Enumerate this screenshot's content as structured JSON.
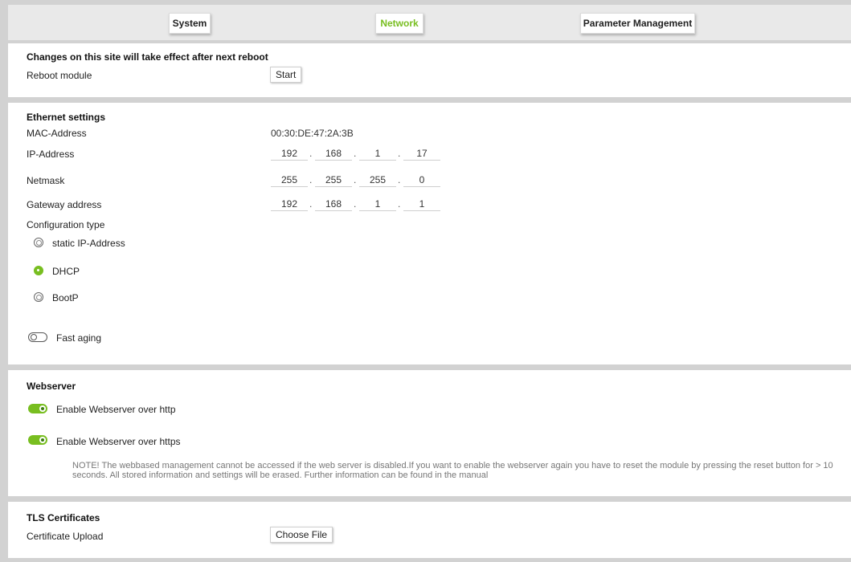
{
  "tabs": [
    {
      "label": "System",
      "active": false
    },
    {
      "label": "Network",
      "active": true
    },
    {
      "label": "Parameter Management",
      "active": false
    }
  ],
  "reboot": {
    "heading": "Changes on this site will take effect after next reboot",
    "label": "Reboot module",
    "button": "Start"
  },
  "ethernet": {
    "heading": "Ethernet settings",
    "mac_label": "MAC-Address",
    "mac_value": "00:30:DE:47:2A:3B",
    "ip_label": "IP-Address",
    "ip": [
      "192",
      "168",
      "1",
      "17"
    ],
    "netmask_label": "Netmask",
    "netmask": [
      "255",
      "255",
      "255",
      "0"
    ],
    "gateway_label": "Gateway address",
    "gateway": [
      "192",
      "168",
      "1",
      "1"
    ],
    "config_label": "Configuration type",
    "config_options": [
      {
        "label": "static IP-Address",
        "selected": false
      },
      {
        "label": "DHCP",
        "selected": true
      },
      {
        "label": "BootP",
        "selected": false
      }
    ],
    "fast_aging_label": "Fast aging",
    "fast_aging_on": false
  },
  "webserver": {
    "heading": "Webserver",
    "http_label": "Enable Webserver over http",
    "http_on": true,
    "https_label": "Enable Webserver over https",
    "https_on": true,
    "note": "NOTE! The webbased management cannot be accessed if the web server is disabled.If you want to enable the webserver again you have to reset the module by pressing the reset button for > 10 seconds. All stored information and settings will be erased. Further information can be found in the manual"
  },
  "tls": {
    "heading": "TLS Certificates",
    "upload_label": "Certificate Upload",
    "button": "Choose File"
  },
  "colors": {
    "accent": "#78be20",
    "background": "#d2d2d2",
    "panel": "#ffffff"
  }
}
